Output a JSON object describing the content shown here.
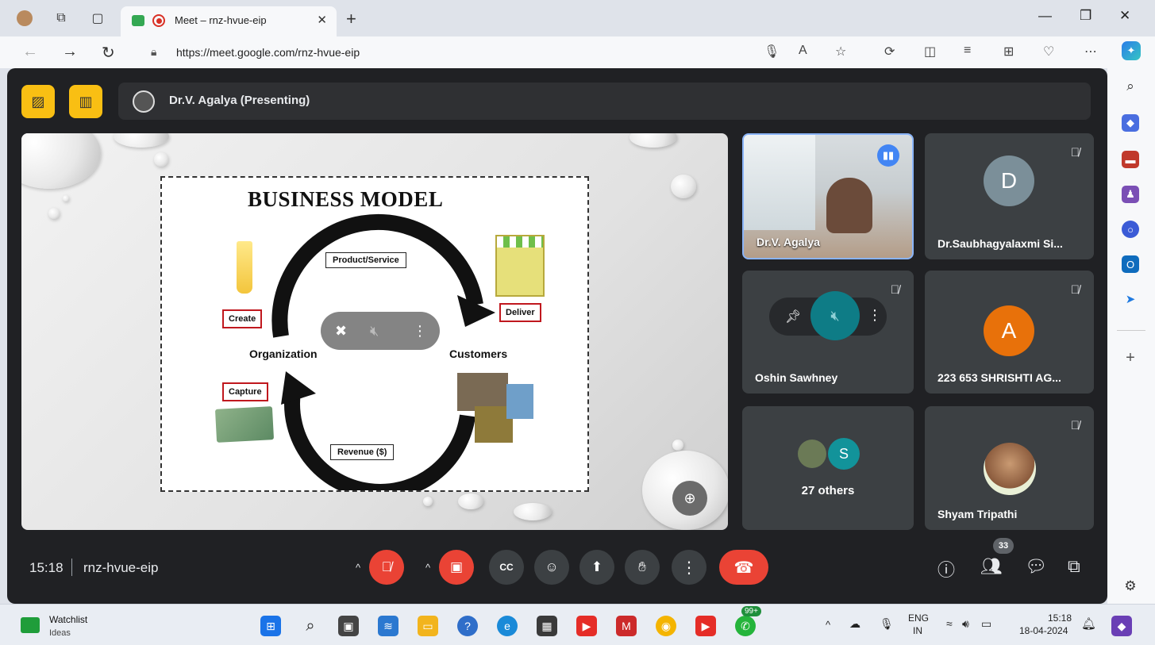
{
  "browser": {
    "tab_title": "Meet – rnz-hvue-eip",
    "url": "https://meet.google.com/rnz-hvue-eip"
  },
  "meet": {
    "presenter_label": "Dr.V. Agalya (Presenting)",
    "meeting_time": "15:18",
    "meeting_code": "rnz-hvue-eip",
    "people_count": "33",
    "slide": {
      "title": "BUSINESS MODEL",
      "product_service": "Product/Service",
      "create": "Create",
      "deliver": "Deliver",
      "organization": "Organization",
      "customers": "Customers",
      "capture": "Capture",
      "revenue": "Revenue ($)"
    },
    "participants": [
      {
        "name": "Dr.V. Agalya",
        "state": "speaking"
      },
      {
        "name": "Dr.Saubhagyalaxmi Si...",
        "initial": "D",
        "color": "#7b8f99",
        "state": "muted"
      },
      {
        "name": "Oshin Sawhney",
        "state": "muted"
      },
      {
        "name": "223 653 SHRISHTI AG...",
        "initial": "A",
        "color": "#e8710a",
        "state": "muted"
      },
      {
        "name": "27 others",
        "initial": "S",
        "color": "#12939a"
      },
      {
        "name": "Shyam Tripathi",
        "state": "muted"
      }
    ]
  },
  "taskbar": {
    "watchlist_title": "Watchlist",
    "watchlist_sub": "Ideas",
    "lang_top": "ENG",
    "lang_bottom": "IN",
    "time": "15:18",
    "date": "18-04-2024",
    "whatsapp_badge": "99+"
  }
}
